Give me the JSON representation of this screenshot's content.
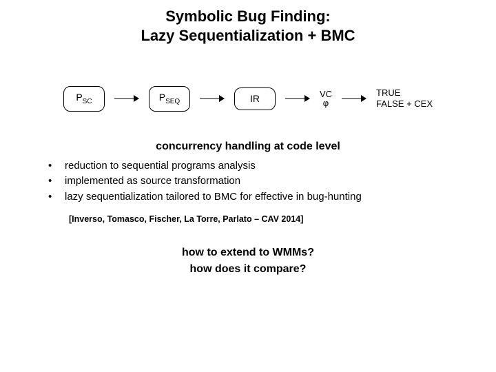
{
  "title_line1": "Symbolic Bug Finding:",
  "title_line2": "Lazy Sequentialization + BMC",
  "pipeline": {
    "p_sc_base": "P",
    "p_sc_sub": "SC",
    "p_seq_base": "P",
    "p_seq_sub": "SEQ",
    "ir": "IR",
    "vc_top": "VC",
    "vc_bot": "φ",
    "true": "TRUE",
    "false": "FALSE + CEX"
  },
  "subtitle": "concurrency handling at code level",
  "bullets": [
    "reduction to sequential programs analysis",
    "implemented as source transformation",
    "lazy sequentialization tailored to BMC for effective in bug-hunting"
  ],
  "citation": "[Inverso, Tomasco, Fischer, La Torre, Parlato – CAV 2014]",
  "question1": "how to extend to WMMs?",
  "question2": "how does it compare?"
}
